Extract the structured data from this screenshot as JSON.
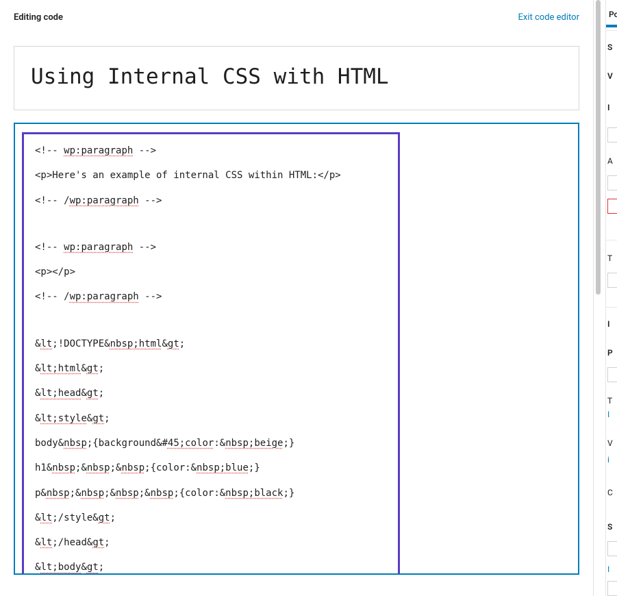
{
  "topbar": {
    "editing_label": "Editing code",
    "exit_label": "Exit code editor"
  },
  "title": "Using Internal CSS with HTML",
  "code_lines": [
    {
      "t": "<!-- ",
      "sq": "wp:paragraph",
      "t2": " -->"
    },
    {
      "plain": "<p>Here's an example of internal CSS within HTML:</p>"
    },
    {
      "t": "<!-- /",
      "sq": "wp:paragraph",
      "t2": " -->"
    },
    {
      "blank": true
    },
    {
      "t": "<!-- ",
      "sq": "wp:paragraph",
      "t2": " -->"
    },
    {
      "plain": "<p></p>"
    },
    {
      "t": "<!-- /",
      "sq": "wp:paragraph",
      "t2": " -->"
    },
    {
      "blank": true
    },
    {
      "segs": [
        {
          "p": "&"
        },
        {
          "s": "lt"
        },
        {
          "p": ";!DOCTYPE&"
        },
        {
          "s": "nbsp;html"
        },
        {
          "p": "&"
        },
        {
          "s": "gt"
        },
        {
          "p": ";"
        }
      ]
    },
    {
      "segs": [
        {
          "p": "&"
        },
        {
          "s": "lt;html"
        },
        {
          "p": "&"
        },
        {
          "s": "gt"
        },
        {
          "p": ";"
        }
      ]
    },
    {
      "segs": [
        {
          "p": "&"
        },
        {
          "s": "lt;head"
        },
        {
          "p": "&"
        },
        {
          "s": "gt"
        },
        {
          "p": ";"
        }
      ]
    },
    {
      "segs": [
        {
          "p": "&"
        },
        {
          "s": "lt;style"
        },
        {
          "p": "&"
        },
        {
          "s": "gt"
        },
        {
          "p": ";"
        }
      ]
    },
    {
      "segs": [
        {
          "p": "body&"
        },
        {
          "s": "nbsp"
        },
        {
          "p": ";{background&#"
        },
        {
          "s": "45;color"
        },
        {
          "p": ":&"
        },
        {
          "s": "nbsp;beige"
        },
        {
          "p": ";}"
        }
      ]
    },
    {
      "segs": [
        {
          "p": "h1&"
        },
        {
          "s": "nbsp"
        },
        {
          "p": ";&"
        },
        {
          "s": "nbsp"
        },
        {
          "p": ";&"
        },
        {
          "s": "nbsp"
        },
        {
          "p": ";{color:&"
        },
        {
          "s": "nbsp;blue"
        },
        {
          "p": ";}"
        }
      ]
    },
    {
      "segs": [
        {
          "p": "p&"
        },
        {
          "s": "nbsp"
        },
        {
          "p": ";&"
        },
        {
          "s": "nbsp"
        },
        {
          "p": ";&"
        },
        {
          "s": "nbsp"
        },
        {
          "p": ";&"
        },
        {
          "s": "nbsp"
        },
        {
          "p": ";{color:&"
        },
        {
          "s": "nbsp;black"
        },
        {
          "p": ";}"
        }
      ]
    },
    {
      "segs": [
        {
          "p": "&"
        },
        {
          "s": "lt"
        },
        {
          "p": ";/style&"
        },
        {
          "s": "gt"
        },
        {
          "p": ";"
        }
      ]
    },
    {
      "segs": [
        {
          "p": "&"
        },
        {
          "s": "lt"
        },
        {
          "p": ";/head&"
        },
        {
          "s": "gt"
        },
        {
          "p": ";"
        }
      ]
    },
    {
      "segs": [
        {
          "p": "&"
        },
        {
          "s": "lt;body"
        },
        {
          "p": "&"
        },
        {
          "s": "gt"
        },
        {
          "p": ";"
        }
      ]
    }
  ],
  "sidebar": {
    "tab": "Post",
    "items": [
      "S",
      "V",
      "I",
      "",
      "A",
      "",
      "",
      "I",
      "",
      "P",
      "",
      "T",
      "I",
      "V",
      "i",
      "C",
      "S",
      "",
      "I",
      ""
    ]
  }
}
